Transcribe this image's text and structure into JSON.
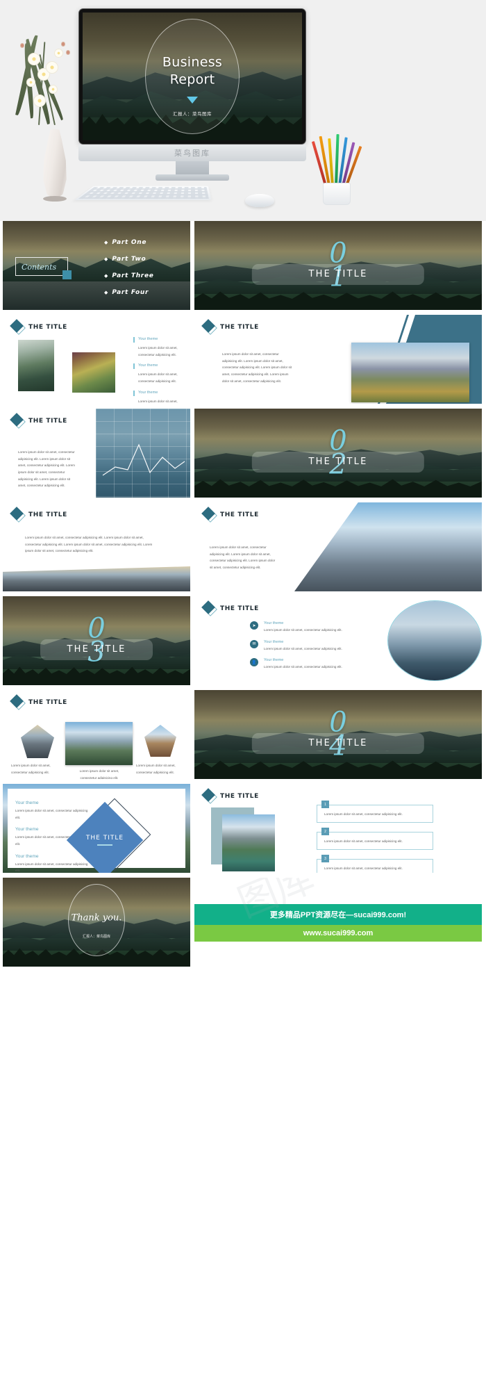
{
  "hero": {
    "title_line1": "Business",
    "title_line2": "Report",
    "presenter": "汇报人：菜鸟图库",
    "brand": "菜鸟图库",
    "watermark": "图库"
  },
  "slides": {
    "contents": {
      "label": "Contents",
      "items": [
        "Part One",
        "Part Two",
        "Part Three",
        "Part Four"
      ],
      "bullet": "◆"
    },
    "section_title": "THE TITLE",
    "sections": [
      {
        "number": "0\n1",
        "num_top": "0",
        "num_bottom": "1",
        "title": "THE TITLE"
      },
      {
        "number": "0\n2",
        "num_top": "0",
        "num_bottom": "2",
        "title": "THE TITLE"
      },
      {
        "number": "0\n3",
        "num_top": "0",
        "num_bottom": "3",
        "title": "THE TITLE"
      },
      {
        "number": "0\n4",
        "num_top": "0",
        "num_bottom": "4",
        "title": "THE TITLE"
      }
    ],
    "slide_title": "THE TITLE",
    "theme_label": "Your theme",
    "body_short": "Lorem ipsum dolor sit amet, consectetur adipisicing elit.",
    "body_medium": "Lorem ipsum dolor sit amet, consectetur adipisicing elit. Lorem ipsum dolor sit amet,  consectetur adipisicing elit. Lorem ipsum dolor sit amet, consectetur adipisicing elit.",
    "body_long": "Lorem ipsum dolor sit amet, consectetur adipisicing elit. Lorem ipsum dolor sit amet,  consectetur adipisicing elit. Lorem ipsum dolor sit amet, consectetur adipisicing elit. Lorem ipsum dolor sit amet, consectetur adipisicing elit.",
    "numbers": [
      "1",
      "2",
      "3"
    ],
    "icons": [
      "paper-plane-icon",
      "chat-icon",
      "user-icon"
    ],
    "icon_glyphs": [
      "➤",
      "✉",
      "👤"
    ],
    "thankyou": {
      "text": "Thank you.",
      "presenter": "汇报人：菜鸟图库"
    }
  },
  "footer": {
    "banner_top": "更多精品PPT资源尽在—sucai999.com!",
    "banner_bottom": "www.sucai999.com",
    "teal": "#12b089",
    "green": "#7ac943"
  },
  "colors": {
    "accent_teal": "#2d6c80",
    "accent_light": "#7fc4d6",
    "cyan": "#79d6ea",
    "blue": "#4d82bd"
  }
}
